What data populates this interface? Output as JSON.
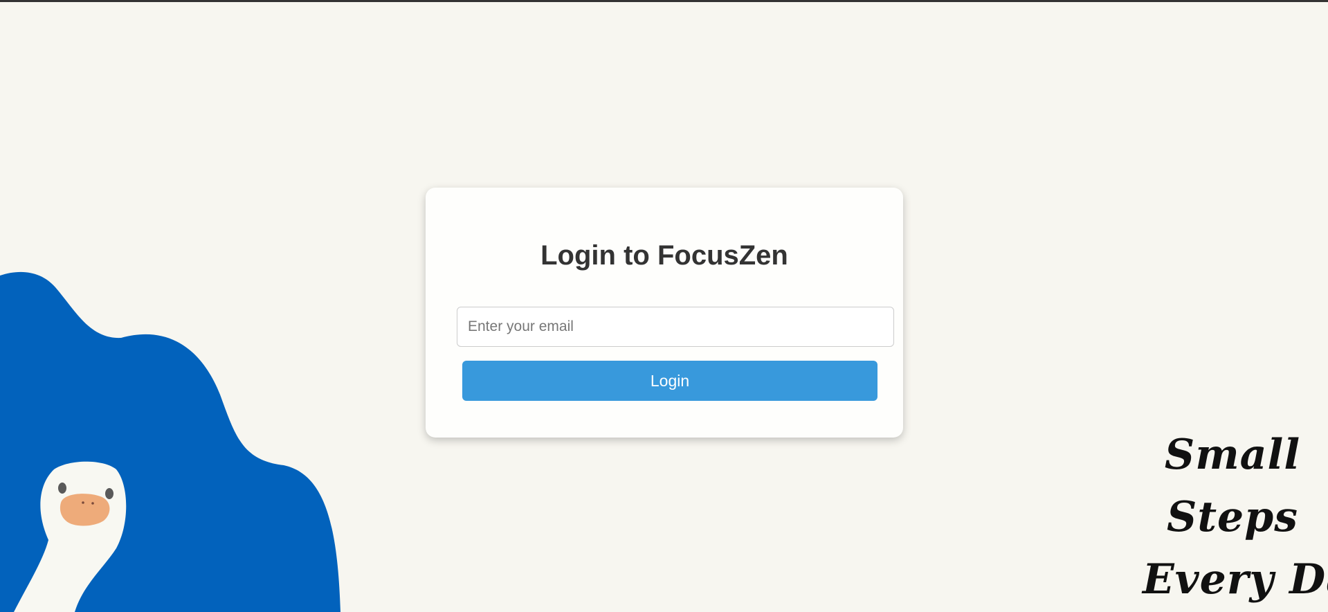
{
  "login": {
    "title": "Login to FocusZen",
    "email_placeholder": "Enter your email",
    "button_label": "Login"
  },
  "motto": {
    "lines": [
      "Small",
      "Steps",
      "Every Day"
    ]
  },
  "colors": {
    "background": "#f7f6f0",
    "card": "#fefefc",
    "accent_button": "#3899dc",
    "title_text": "#333333",
    "blob": "#0262bc",
    "duck": "#f8f8f2",
    "beak": "#eeab7a",
    "motto_text": "#111111"
  },
  "icons": {
    "illustration": "duck-illustration-icon"
  }
}
